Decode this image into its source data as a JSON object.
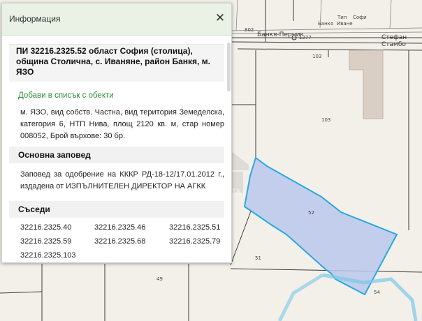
{
  "popup": {
    "title": "Информация",
    "close_label": "✕",
    "parcel_title": "ПИ 32216.2325.52 област София (столица), община Столична, с. Иваняне, район Банкя, м. ЯЗО",
    "add_link": "Добави в списък с обекти",
    "description": "м. ЯЗО, вид собств. Частна, вид територия Земеделска, категория 6, НТП Нива, площ 2120 кв. м, стар номер 008052, Брой върхове: 30 бр.",
    "order_heading": "Основна заповед",
    "order_text": "Заповед за одобрение на КККР РД-18-12/17.01.2012 г., издадена от ИЗПЪЛНИТЕЛЕН ДИРЕКТОР НА АГКК",
    "neighbors_heading": "Съседи",
    "neighbors": [
      "32216.2325.40",
      "32216.2325.46",
      "32216.2325.51",
      "32216.2325.59",
      "32216.2325.68",
      "32216.2325.79",
      "32216.2325.103"
    ]
  },
  "map": {
    "street_main": "Стефан Стамбо",
    "street_road": "Банкя-Перник",
    "street_small_1": "Тип",
    "street_small_2": "Софи",
    "street_small_3": "Банкя",
    "street_small_4": "Иване",
    "label_802": "802",
    "label_1277": "1277",
    "parcel_labels": [
      "103",
      "103",
      "52",
      "51",
      "49",
      "54"
    ],
    "watermark_text": "REAL ESTA",
    "selected_fill": "#b8c8ec",
    "selected_stroke": "#2aa8e0",
    "building_fill": "#d9cfc4"
  },
  "colors": {
    "header_bg": "#e9f2e4",
    "link": "#2e8f3a"
  }
}
